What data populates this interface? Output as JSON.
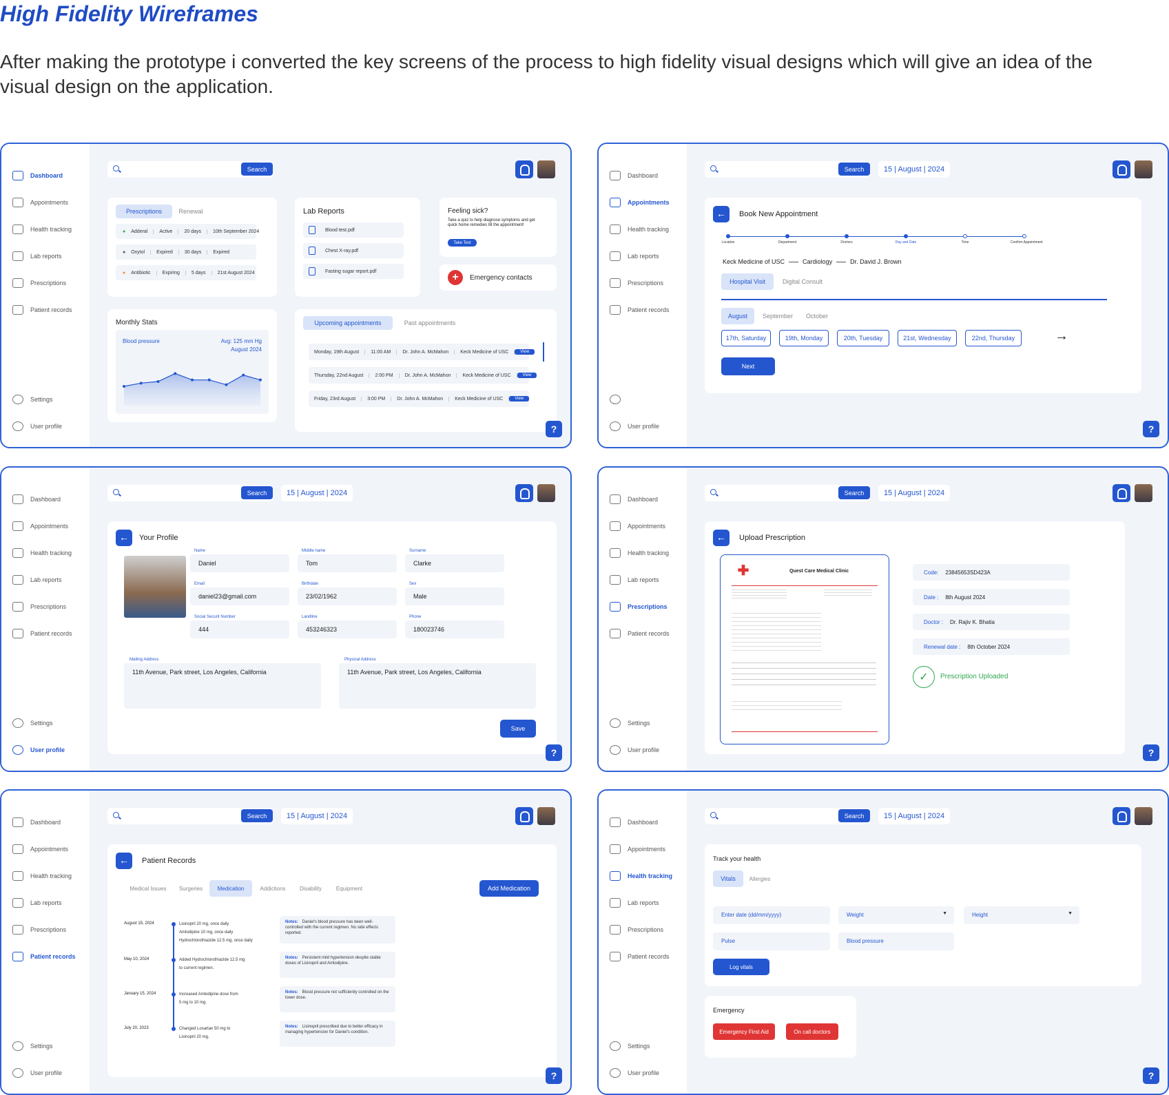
{
  "heading": "High Fidelity Wireframes",
  "intro": "After making the prototype i converted the key screens of the process to high fidelity visual designs which will give an idea of the visual design on the application.",
  "nav": {
    "dashboard": "Dashboard",
    "appointments": "Appointments",
    "health": "Health tracking",
    "lab": "Lab reports",
    "prescriptions": "Prescriptions",
    "records": "Patient records",
    "settings": "Settings",
    "profile": "User profile"
  },
  "search_label": "Search",
  "date_label": "15 | August | 2024",
  "help": "?",
  "s1": {
    "tabs": [
      "Prescriptions",
      "Renewal"
    ],
    "rx": [
      [
        "Adderal",
        "Active",
        "20 days",
        "10th September 2024"
      ],
      [
        "Oxytol",
        "Expired",
        "30 days",
        "Expired"
      ],
      [
        "Antibiotic",
        "Expiring",
        "5 days",
        "21st August 2024"
      ]
    ],
    "rx_colors": [
      "#2fa84f",
      "#555555",
      "#f08a3a"
    ],
    "lab_title": "Lab Reports",
    "labs": [
      "Blood test.pdf",
      "Chest X-ray.pdf",
      "Fasting sugar report.pdf"
    ],
    "sick_title": "Feeling sick?",
    "sick_text": "Take a quiz to help diagnose symptoms and get quick home remedies till the appointment!",
    "sick_btn": "Take Test",
    "emergency": "Emergency contacts",
    "stats_title": "Monthly Stats",
    "stats_label": "Blood pressure",
    "stats_avg": "Avg: 125 mm Hg",
    "stats_month": "August 2024",
    "appt_tabs": [
      "Upcoming appointments",
      "Past appointments"
    ],
    "appts": [
      [
        "Monday, 19th August",
        "11:00 AM",
        "Dr. John A. McMahon",
        "Keck Medicine of USC",
        "View"
      ],
      [
        "Thursday, 22nd August",
        "2:00 PM",
        "Dr. John A. McMahon",
        "Keck Medicine of USC",
        "View"
      ],
      [
        "Friday, 23rd August",
        "3:00 PM",
        "Dr. John A. McMahon",
        "Keck Medicine of USC",
        "View"
      ]
    ]
  },
  "chart_data": {
    "type": "area",
    "title": "Monthly Stats",
    "series": [
      {
        "name": "Blood pressure",
        "values": [
          122,
          124,
          125,
          130,
          126,
          126,
          123,
          129,
          126
        ]
      }
    ],
    "ylim": [
      110,
      140
    ]
  },
  "s2": {
    "title": "Book New Appointment",
    "steps": [
      "Location",
      "Department",
      "Doctors",
      "Day and Date",
      "Time",
      "Confirm Appointment"
    ],
    "path": [
      "Keck Medicine of USC",
      "Cardiology",
      "Dr. David J. Brown"
    ],
    "visit": [
      "Hospital Visit",
      "Digital Consult"
    ],
    "months": [
      "August",
      "September",
      "October"
    ],
    "days": [
      "17th, Saturday",
      "19th, Monday",
      "20th, Tuesday",
      "21st, Wednesday",
      "22nd, Thursday"
    ],
    "arrow": "→",
    "next": "Next"
  },
  "s3": {
    "title": "Your Profile",
    "fields": [
      [
        "Name",
        "Daniel"
      ],
      [
        "Middle name",
        "Tom"
      ],
      [
        "Surname",
        "Clarke"
      ],
      [
        "Email",
        "daniel23@gmail.com"
      ],
      [
        "Birthdate",
        "23/02/1962"
      ],
      [
        "Sex",
        "Male"
      ],
      [
        "Social Securit Number",
        "444"
      ],
      [
        "Landline",
        "453246323"
      ],
      [
        "Phone",
        "180023746"
      ]
    ],
    "mail_label": "Mailing Address",
    "mail": "11th Avenue, Park street, Los Angeles, California",
    "phys_label": "Physical Address",
    "phys": "11th Avenue, Park street, Los Angeles, California",
    "save": "Save"
  },
  "s4": {
    "title": "Upload Prescription",
    "clinic": "Quest Care Medical Clinic",
    "fields": [
      [
        "Code:",
        "23845653SD423A"
      ],
      [
        "Date :",
        "8th August 2024"
      ],
      [
        "Doctor :",
        "Dr. Rajiv K. Bhatia"
      ],
      [
        "Renewal date :",
        "8th October 2024"
      ]
    ],
    "uploaded": "Prescription Uploaded"
  },
  "s5": {
    "title": "Patient Records",
    "tabs": [
      "Medical Issues",
      "Surgeries",
      "Medication",
      "Addictions",
      "Disability",
      "Equipment"
    ],
    "add": "Add Medication",
    "entries": [
      {
        "date": "August 15, 2024",
        "text": [
          "Lisinopril 20 mg, once daily",
          "Amlodipine 10 mg, once daily",
          "Hydrochlorothiazide 12.5 mg, once daily"
        ],
        "note_label": "Notes:",
        "note": "Daniel's blood pressure has been well-controlled with the current regimen. No side effects reported."
      },
      {
        "date": "May 10, 2024",
        "text": [
          "Added Hydrochlorothiazide 12.5 mg",
          "to current regimen."
        ],
        "note_label": "Notes:",
        "note": "Persistent mild hypertension despite stable doses of Lisinopril and Amlodipine."
      },
      {
        "date": "January 15, 2024",
        "text": [
          "Increased Amlodipine dose from",
          "5 mg to 10 mg."
        ],
        "note_label": "Notes:",
        "note": "Blood pressure not sufficiently controlled on the lower dose."
      },
      {
        "date": "July 20, 2023",
        "text": [
          "Changed Losartan 50 mg to",
          "Lisinopril 20 mg."
        ],
        "note_label": "Notes:",
        "note": "Lisinopril prescribed due to better efficacy in managing hypertension for Daniel's condition."
      }
    ]
  },
  "s6": {
    "title": "Track your health",
    "tabs": [
      "Vitals",
      "Allergies"
    ],
    "fields": [
      "Enter date (dd/mm/yyyy)",
      "Weight",
      "Height",
      "Pulse",
      "Blood pressure"
    ],
    "log": "Log vitals",
    "emergency_title": "Emergency",
    "first_aid": "Emergency First Aid",
    "on_call": "On call doctors"
  }
}
